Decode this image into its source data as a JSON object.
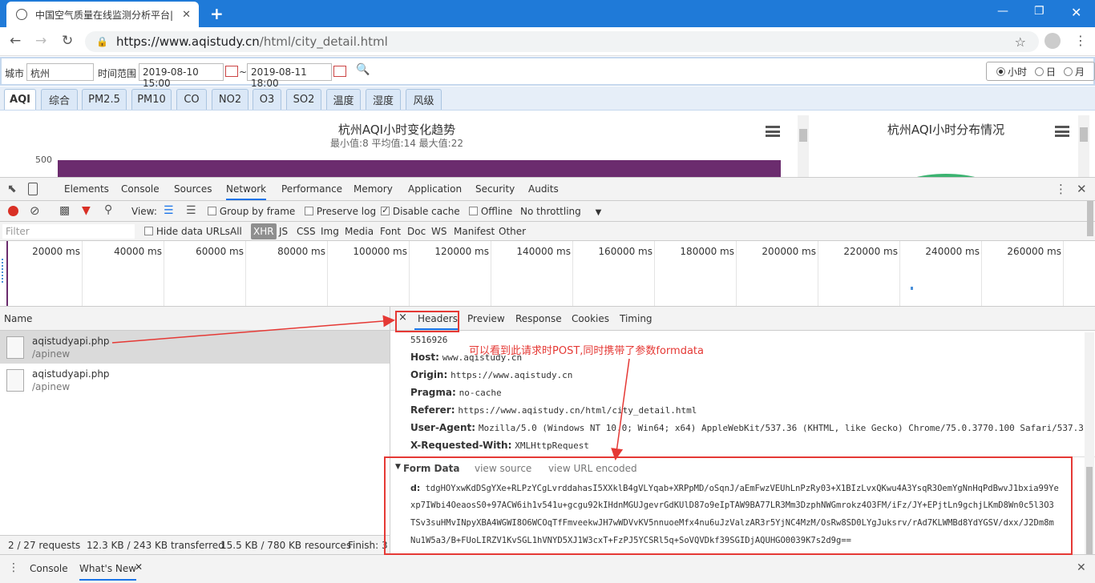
{
  "browser": {
    "tab_title": "中国空气质量在线监测分析平台|",
    "tab_close": "✕",
    "new_tab": "+",
    "url_domain": "https://www.aqistudy.cn",
    "url_path": "/html/city_detail.html"
  },
  "filter": {
    "city_label": "城市",
    "city_value": "杭州",
    "range_label": "时间范围",
    "start": "2019-08-10 15:00",
    "tilde": "~",
    "end": "2019-08-11 18:00",
    "radio_hour": "小时",
    "radio_day": "日",
    "radio_month": "月"
  },
  "page_tabs": [
    "AQI",
    "综合",
    "PM2.5",
    "PM10",
    "CO",
    "NO2",
    "O3",
    "SO2",
    "温度",
    "湿度",
    "风级"
  ],
  "charts": {
    "left_title": "杭州AQI小时变化趋势",
    "left_subtitle": "最小值:8 平均值:14 最大值:22",
    "left_ytick": "500",
    "right_title": "杭州AQI小时分布情况"
  },
  "devtools": {
    "panels": [
      "Elements",
      "Console",
      "Sources",
      "Network",
      "Performance",
      "Memory",
      "Application",
      "Security",
      "Audits"
    ],
    "toolbar": {
      "view": "View:",
      "group_by_frame": "Group by frame",
      "preserve_log": "Preserve log",
      "disable_cache": "Disable cache",
      "offline": "Offline",
      "throttling": "No throttling"
    },
    "filter_bar": {
      "placeholder": "Filter",
      "hide_data_urls": "Hide data URLs",
      "types": [
        "All",
        "XHR",
        "JS",
        "CSS",
        "Img",
        "Media",
        "Font",
        "Doc",
        "WS",
        "Manifest",
        "Other"
      ]
    },
    "timeline_ticks": [
      "20000 ms",
      "40000 ms",
      "60000 ms",
      "80000 ms",
      "100000 ms",
      "120000 ms",
      "140000 ms",
      "160000 ms",
      "180000 ms",
      "200000 ms",
      "220000 ms",
      "240000 ms",
      "260000 ms"
    ],
    "name_header": "Name",
    "requests": [
      {
        "name": "aqistudyapi.php",
        "path": "/apinew"
      },
      {
        "name": "aqistudyapi.php",
        "path": "/apinew"
      }
    ],
    "detail_tabs": [
      "Headers",
      "Preview",
      "Response",
      "Cookies",
      "Timing"
    ],
    "headers": {
      "partial": "5516926",
      "host_k": "Host:",
      "host_v": "www.aqistudy.cn",
      "origin_k": "Origin:",
      "origin_v": "https://www.aqistudy.cn",
      "pragma_k": "Pragma:",
      "pragma_v": "no-cache",
      "referer_k": "Referer:",
      "referer_v": "https://www.aqistudy.cn/html/city_detail.html",
      "ua_k": "User-Agent:",
      "ua_v": "Mozilla/5.0 (Windows NT 10.0; Win64; x64) AppleWebKit/537.36 (KHTML, like Gecko) Chrome/75.0.3770.100 Safari/537.36",
      "xrw_k": "X-Requested-With:",
      "xrw_v": "XMLHttpRequest"
    },
    "form_data": {
      "title": "Form Data",
      "view_source": "view source",
      "view_url_encoded": "view URL encoded",
      "key": "d:",
      "lines": [
        "tdgHOYxwKdDSgYXe+RLPzYCgLvrddahasI5XXklB4gVLYqab+XRPpMD/oSqnJ/aEmFwzVEUhLnPzRy03+X1BIzLvxQKwu4A3YsqR3OemYgNnHqPdBwvJ1bxia99Ye",
        "xp7IWbi4OeaosS0+97ACW6ih1v541u+gcgu92kIHdnMGUJgevrGdKUlD87o9eIpTAW9BA77LR3Mm3DzphNWGmrokz4O3FM/iFz/JY+EPjtLn9gchjLKmD8Wn0c5l3O3",
        "TSv3suHMvINpyXBA4WGWI8O6WCOqTfFmveekwJH7wWDVvKV5nnuoeMfx4nu6uJzValzAR3r5YjNC4MzM/OsRw8SD0LYgJuksrv/rAd7KLWMBd8YdYGSV/dxx/J2Dm8m",
        "Nu1W5a3/B+FUoLIRZV1KvSGL1hVNYD5XJ1W3cxT+FzPJ5YCSRl5q+SoVQVDkf39SGIDjAQUHGO0039K7s2d9g=="
      ]
    },
    "annotation": "可以看到此请求时POST,同时携带了参数formdata",
    "status": {
      "requests": "2 / 27 requests",
      "transferred": "12.3 KB / 243 KB transferred",
      "resources": "15.5 KB / 780 KB resources",
      "finish": "Finish: 3"
    },
    "drawer_tabs": [
      "Console",
      "What's New"
    ]
  },
  "colors": {
    "browser_blue": "#1f7ad8",
    "annotation_red": "#e53935",
    "chart_purple": "#6b2c6e",
    "chart_green": "#3cb371"
  }
}
